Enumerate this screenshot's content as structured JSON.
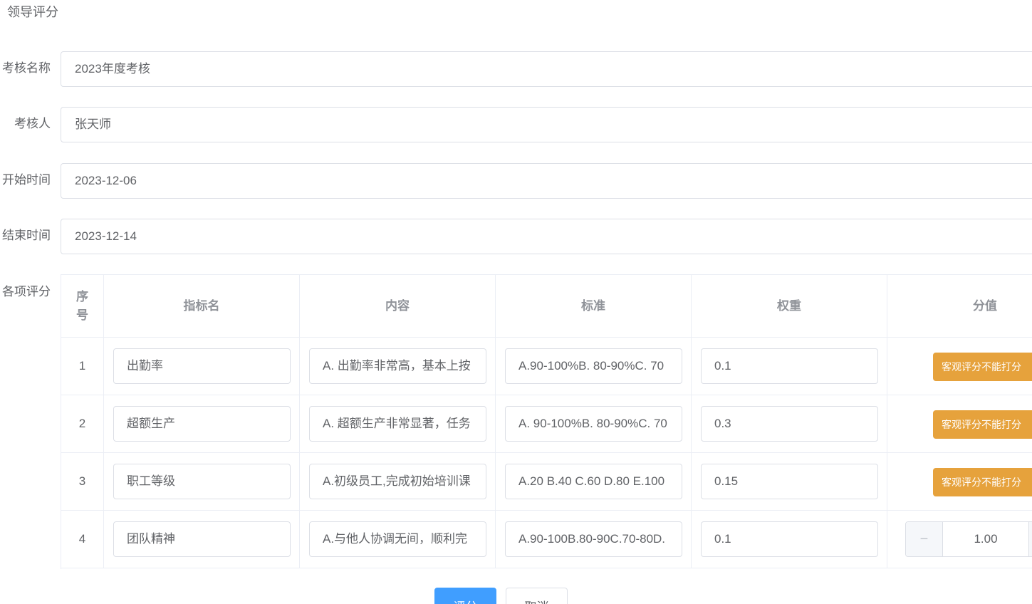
{
  "page": {
    "title": "领导评分"
  },
  "form": {
    "name_label": "考核名称",
    "name_value": "2023年度考核",
    "assessor_label": "考核人",
    "assessor_value": "张天师",
    "start_label": "开始时间",
    "start_value": "2023-12-06",
    "end_label": "结束时间",
    "end_value": "2023-12-14",
    "items_label": "各项评分"
  },
  "table": {
    "headers": {
      "index": "序号",
      "name": "指标名",
      "content": "内容",
      "standard": "标准",
      "weight": "权重",
      "score": "分值"
    },
    "rows": [
      {
        "index": "1",
        "name": "出勤率",
        "content": "A. 出勤率非常高，基本上按",
        "standard": "A.90-100%B. 80-90%C. 70",
        "weight": "0.1",
        "score_button": "客观评分不能打分"
      },
      {
        "index": "2",
        "name": "超额生产",
        "content": "A. 超额生产非常显著，任务",
        "standard": "A. 90-100%B. 80-90%C. 70",
        "weight": "0.3",
        "score_button": "客观评分不能打分"
      },
      {
        "index": "3",
        "name": "职工等级",
        "content": "A.初级员工,完成初始培训课",
        "standard": "A.20 B.40 C.60 D.80 E.100",
        "weight": "0.15",
        "score_button": "客观评分不能打分"
      },
      {
        "index": "4",
        "name": "团队精神",
        "content": "A.与他人协调无间，顺利完",
        "standard": "A.90-100B.80-90C.70-80D.",
        "weight": "0.1",
        "score_value": "1.00",
        "minus": "−"
      }
    ]
  },
  "actions": {
    "submit_label": "评分",
    "cancel_label": "取消"
  },
  "colors": {
    "primary": "#409eff",
    "warning": "#e6a23c",
    "border": "#dcdfe6"
  }
}
